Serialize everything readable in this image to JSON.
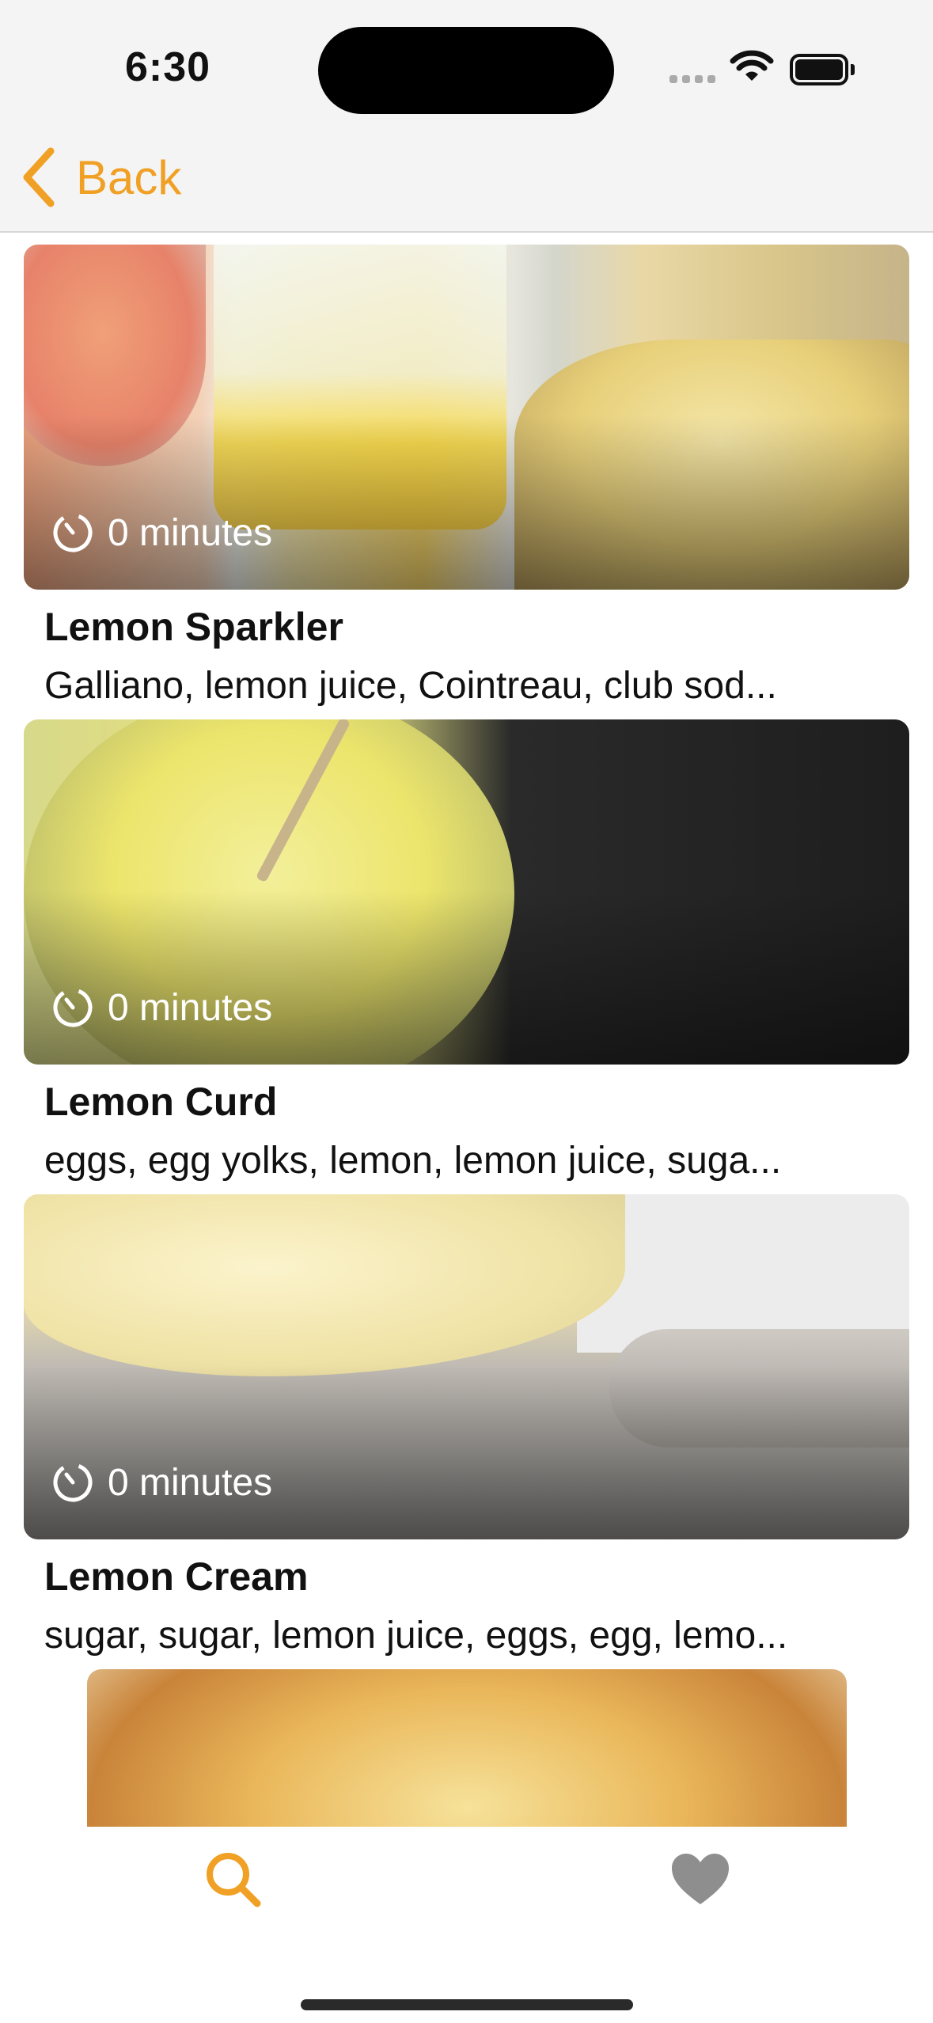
{
  "status_bar": {
    "time": "6:30",
    "icons": [
      "cellular-signal-icon",
      "wifi-icon",
      "battery-icon"
    ]
  },
  "nav": {
    "back_label": "Back",
    "back_icon": "chevron-left-icon",
    "accent_color": "#f0a024"
  },
  "recipes": [
    {
      "title": "Lemon Sparkler",
      "ingredients": "Galliano, lemon juice, Cointreau, club sod...",
      "time": "0 minutes"
    },
    {
      "title": "Lemon Curd",
      "ingredients": "eggs, egg yolks, lemon, lemon juice, suga...",
      "time": "0 minutes"
    },
    {
      "title": "Lemon Cream",
      "ingredients": "sugar, sugar, lemon juice, eggs, egg, lemo...",
      "time": "0 minutes"
    }
  ],
  "tab_bar": {
    "tabs": [
      {
        "icon": "search-icon",
        "selected": true,
        "color": "#f0a024"
      },
      {
        "icon": "heart-icon",
        "selected": false,
        "color": "#8e8e8e"
      }
    ]
  }
}
